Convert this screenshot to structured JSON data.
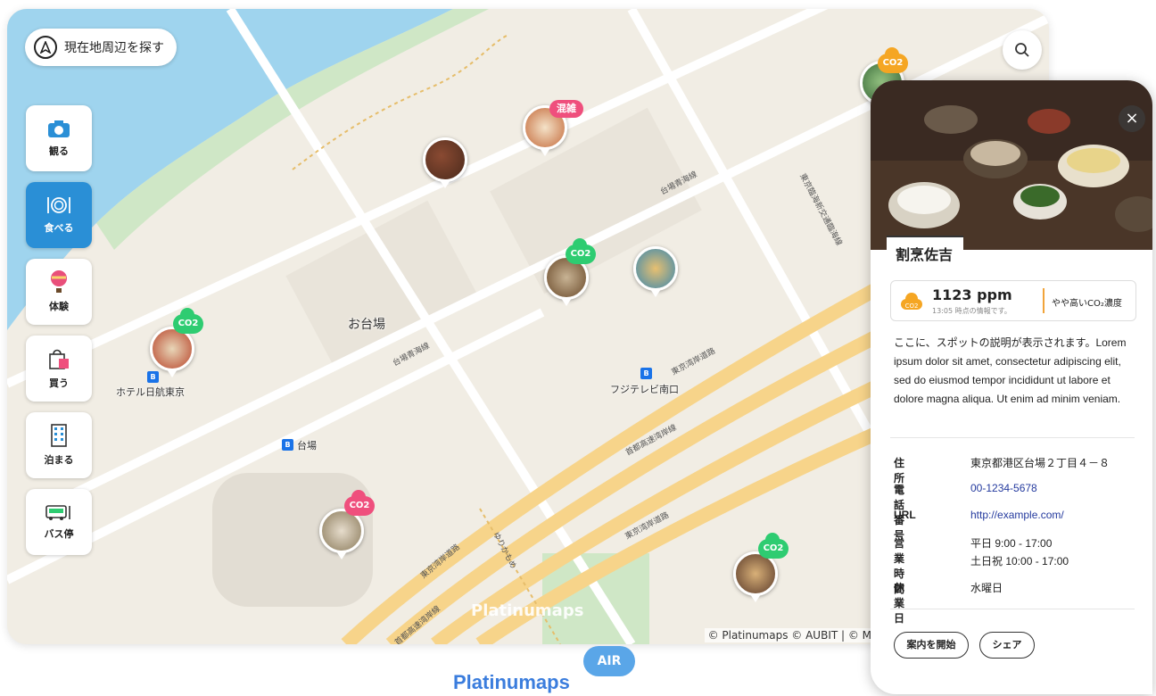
{
  "map": {
    "locate_label": "現在地周辺を探す",
    "area_label": "お台場",
    "stations": [
      {
        "name": "ホテル日航東京"
      },
      {
        "name": "フジテレビ南口"
      },
      {
        "name": "台場"
      }
    ],
    "roads": {
      "r1": "台場青海線",
      "r2": "台場青海線",
      "r3": "東京湾岸道路",
      "r4": "首都高速湾岸線",
      "r5": "東京湾岸道路",
      "r6": "東京湾岸道路",
      "r7": "東京臨海新交通臨海線",
      "r8": "ゆりかもめ",
      "r9": "首都高速湾岸線"
    },
    "badge_crowded": "混雑",
    "co2_label": "CO2",
    "attribution": "© Platinumaps © AUBIT | © Map",
    "watermark": "Platinumaps",
    "colors": {
      "map_bg": "#f1ede4",
      "water": "#9fd4ee",
      "park": "#cfe7c6",
      "highway": "#f7d48a",
      "accent": "#2a8fd6",
      "co2_green": "#2ecc71",
      "co2_orange": "#f5a623",
      "co2_pink": "#ef4f7d",
      "crowded": "#ef4f7d"
    }
  },
  "categories": [
    {
      "label": "観る",
      "icon": "camera-icon",
      "active": false
    },
    {
      "label": "食べる",
      "icon": "dining-icon",
      "active": true
    },
    {
      "label": "体験",
      "icon": "balloon-icon",
      "active": false
    },
    {
      "label": "買う",
      "icon": "shopping-bag-icon",
      "active": false
    },
    {
      "label": "泊まる",
      "icon": "hotel-icon",
      "active": false
    },
    {
      "label": "バス停",
      "icon": "bus-icon",
      "active": false
    }
  ],
  "panel": {
    "title": "割烹佐吉",
    "co2": {
      "value": "1123 ppm",
      "time": "13:05 時点の情報です。",
      "level": "やや高いCO₂濃度"
    },
    "description": "ここに、スポットの説明が表示されます。Lorem ipsum dolor sit amet, consectetur adipiscing elit, sed do eiusmod tempor incididunt ut labore et dolore magna aliqua. Ut enim ad minim veniam.",
    "info": [
      {
        "key": "住所",
        "value": "東京都港区台場２丁目４－８",
        "link": false
      },
      {
        "key": "電話番号",
        "value": "00-1234-5678",
        "link": true
      },
      {
        "key": "URL",
        "value": "http://example.com/",
        "link": true
      },
      {
        "key": "営業時間",
        "value": "平日 9:00 - 17:00",
        "value2": "土日祝 10:00 - 17:00",
        "link": false
      },
      {
        "key": "休業日",
        "value": "水曜日",
        "link": false
      }
    ],
    "start_guide": "案内を開始",
    "share": "シェア"
  },
  "logo": {
    "word": "Platinumaps",
    "air": "AIR"
  }
}
